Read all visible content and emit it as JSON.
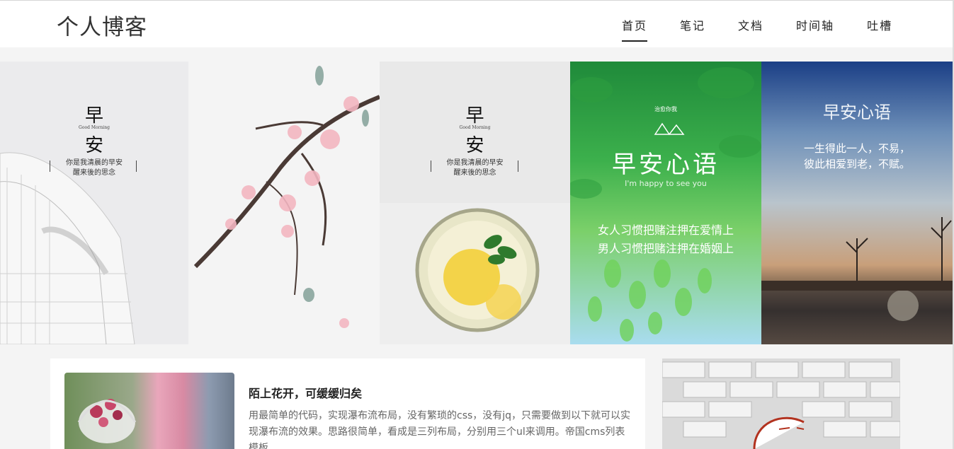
{
  "header": {
    "logo": "个人博客",
    "nav": [
      "首页",
      "笔记",
      "文档",
      "时间轴",
      "吐槽"
    ]
  },
  "banner": {
    "panel1": {
      "char1": "早",
      "en": "Good Morning",
      "char2": "安",
      "line1": "你是我清晨的早安",
      "line2": "醒来後的思念"
    },
    "panel3": {
      "char1": "早",
      "en": "Good Morning",
      "char2": "安",
      "line1": "你是我清晨的早安",
      "line2": "醒来後的思念"
    },
    "panel4": {
      "small": "治愈你我",
      "title": "早安心语",
      "sub": "I'm happy to see you",
      "line1": "女人习惯把赌注押在爱情上",
      "line2": "男人习惯把赌注押在婚姻上"
    },
    "panel5": {
      "title": "早安心语",
      "line1": "一生得此一人，不易，",
      "line2": "彼此相爱到老，不赋。"
    }
  },
  "article": {
    "title": "陌上花开，可缓缓归矣",
    "body": "用最简单的代码，实现瀑布流布局，没有繁琐的css，没有jq，只需要做到以下就可以实现瀑布流的效果。思路很简单，看成是三列布局，分别用三个ul来调用。帝国cms列表模板"
  }
}
